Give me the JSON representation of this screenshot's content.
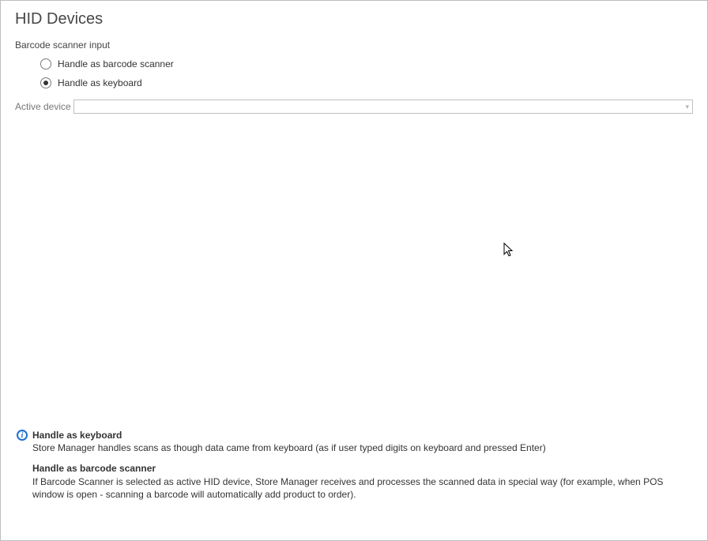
{
  "title": "HID Devices",
  "barcodeSection": {
    "label": "Barcode scanner input",
    "options": [
      {
        "label": "Handle as barcode scanner",
        "selected": false
      },
      {
        "label": "Handle as keyboard",
        "selected": true
      }
    ]
  },
  "activeDevice": {
    "label": "Active device",
    "value": ""
  },
  "info": {
    "iconGlyph": "i",
    "para1heading": "Handle as keyboard",
    "para1body": "Store Manager handles scans as though data came from keyboard (as if user typed digits on keyboard and pressed Enter)",
    "para2heading": "Handle as barcode scanner",
    "para2body": "If Barcode Scanner is selected as active HID device, Store Manager receives and processes the scanned data in special way (for example, when POS window is open - scanning a barcode will automatically add product to order)."
  }
}
